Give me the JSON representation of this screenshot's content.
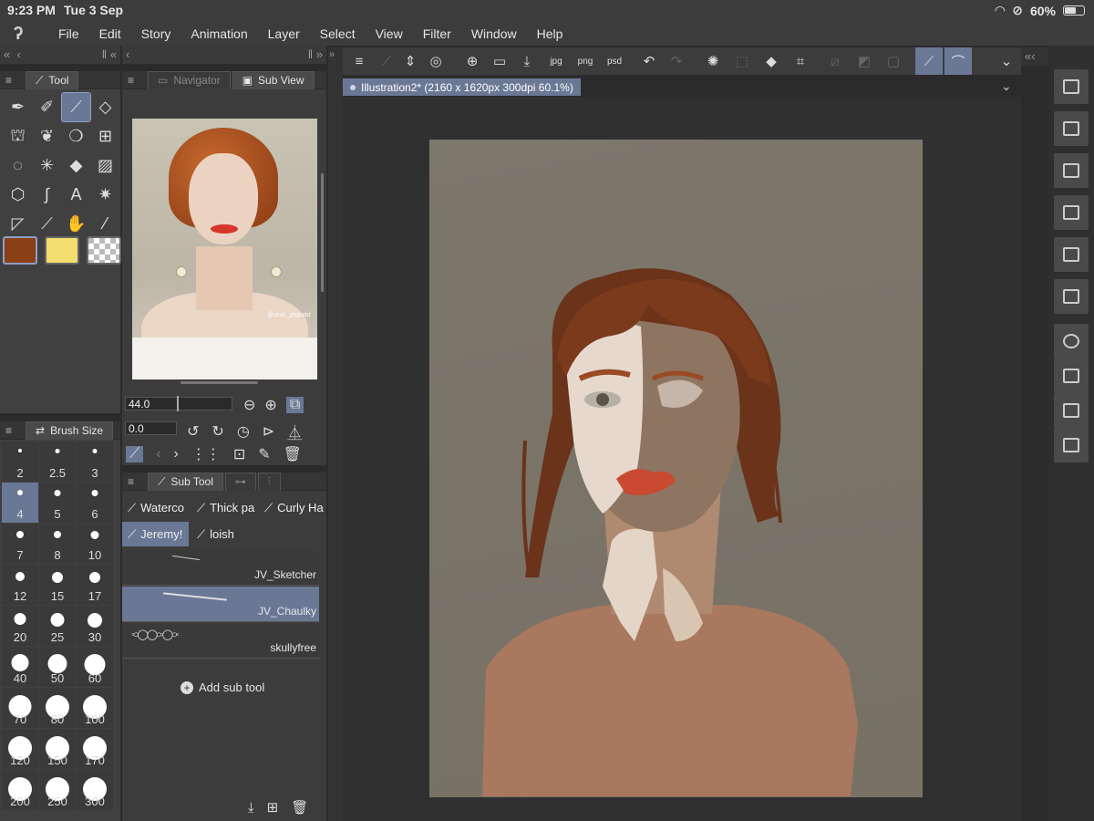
{
  "status": {
    "time": "9:23 PM",
    "date": "Tue 3 Sep",
    "battery": "60%",
    "battery_level": 0.6
  },
  "menu": [
    "File",
    "Edit",
    "Story",
    "Animation",
    "Layer",
    "Select",
    "View",
    "Filter",
    "Window",
    "Help"
  ],
  "tool_panel": {
    "tab": "Tool",
    "tools": [
      "pen-icon",
      "marker-icon",
      "brush-icon",
      "eraser-icon",
      "fill-blend-icon",
      "decoration-icon",
      "blend-icon",
      "grid-icon",
      "lasso-icon",
      "magic-wand-icon",
      "fill-icon",
      "gradient-icon",
      "3d-object-icon",
      "curve-icon",
      "text-icon",
      "burst-icon",
      "ruler-icon",
      "correction-icon",
      "hand-icon",
      "eyedropper-icon"
    ],
    "colors": {
      "main": "#8a3f14",
      "sub": "#f2dd6e"
    }
  },
  "brush_size": {
    "tab": "Brush Size",
    "sizes": [
      "2",
      "2.5",
      "3",
      "4",
      "5",
      "6",
      "7",
      "8",
      "10",
      "12",
      "15",
      "17",
      "20",
      "25",
      "30",
      "40",
      "50",
      "60",
      "70",
      "80",
      "100",
      "120",
      "150",
      "170",
      "200",
      "250",
      "300"
    ],
    "selected": "4"
  },
  "sub_view": {
    "tabs": [
      "Navigator",
      "Sub View"
    ],
    "watermark": "@urso_popular",
    "size_value": "44.0",
    "angle_value": "0.0"
  },
  "sub_tool": {
    "tab": "Sub Tool",
    "groups": [
      "Waterco",
      "Thick pa",
      "Curly Ha",
      "Jeremy!",
      "loish"
    ],
    "selected_group": "Jeremy!",
    "brushes": [
      "JV_Sketcher",
      "JV_Chaulky",
      "skullyfree"
    ],
    "selected_brush": "JV_Chaulky",
    "add_label": "Add sub tool"
  },
  "document": {
    "title": "Illustration2* (2160 x 1620px 300dpi 60.1%)"
  }
}
